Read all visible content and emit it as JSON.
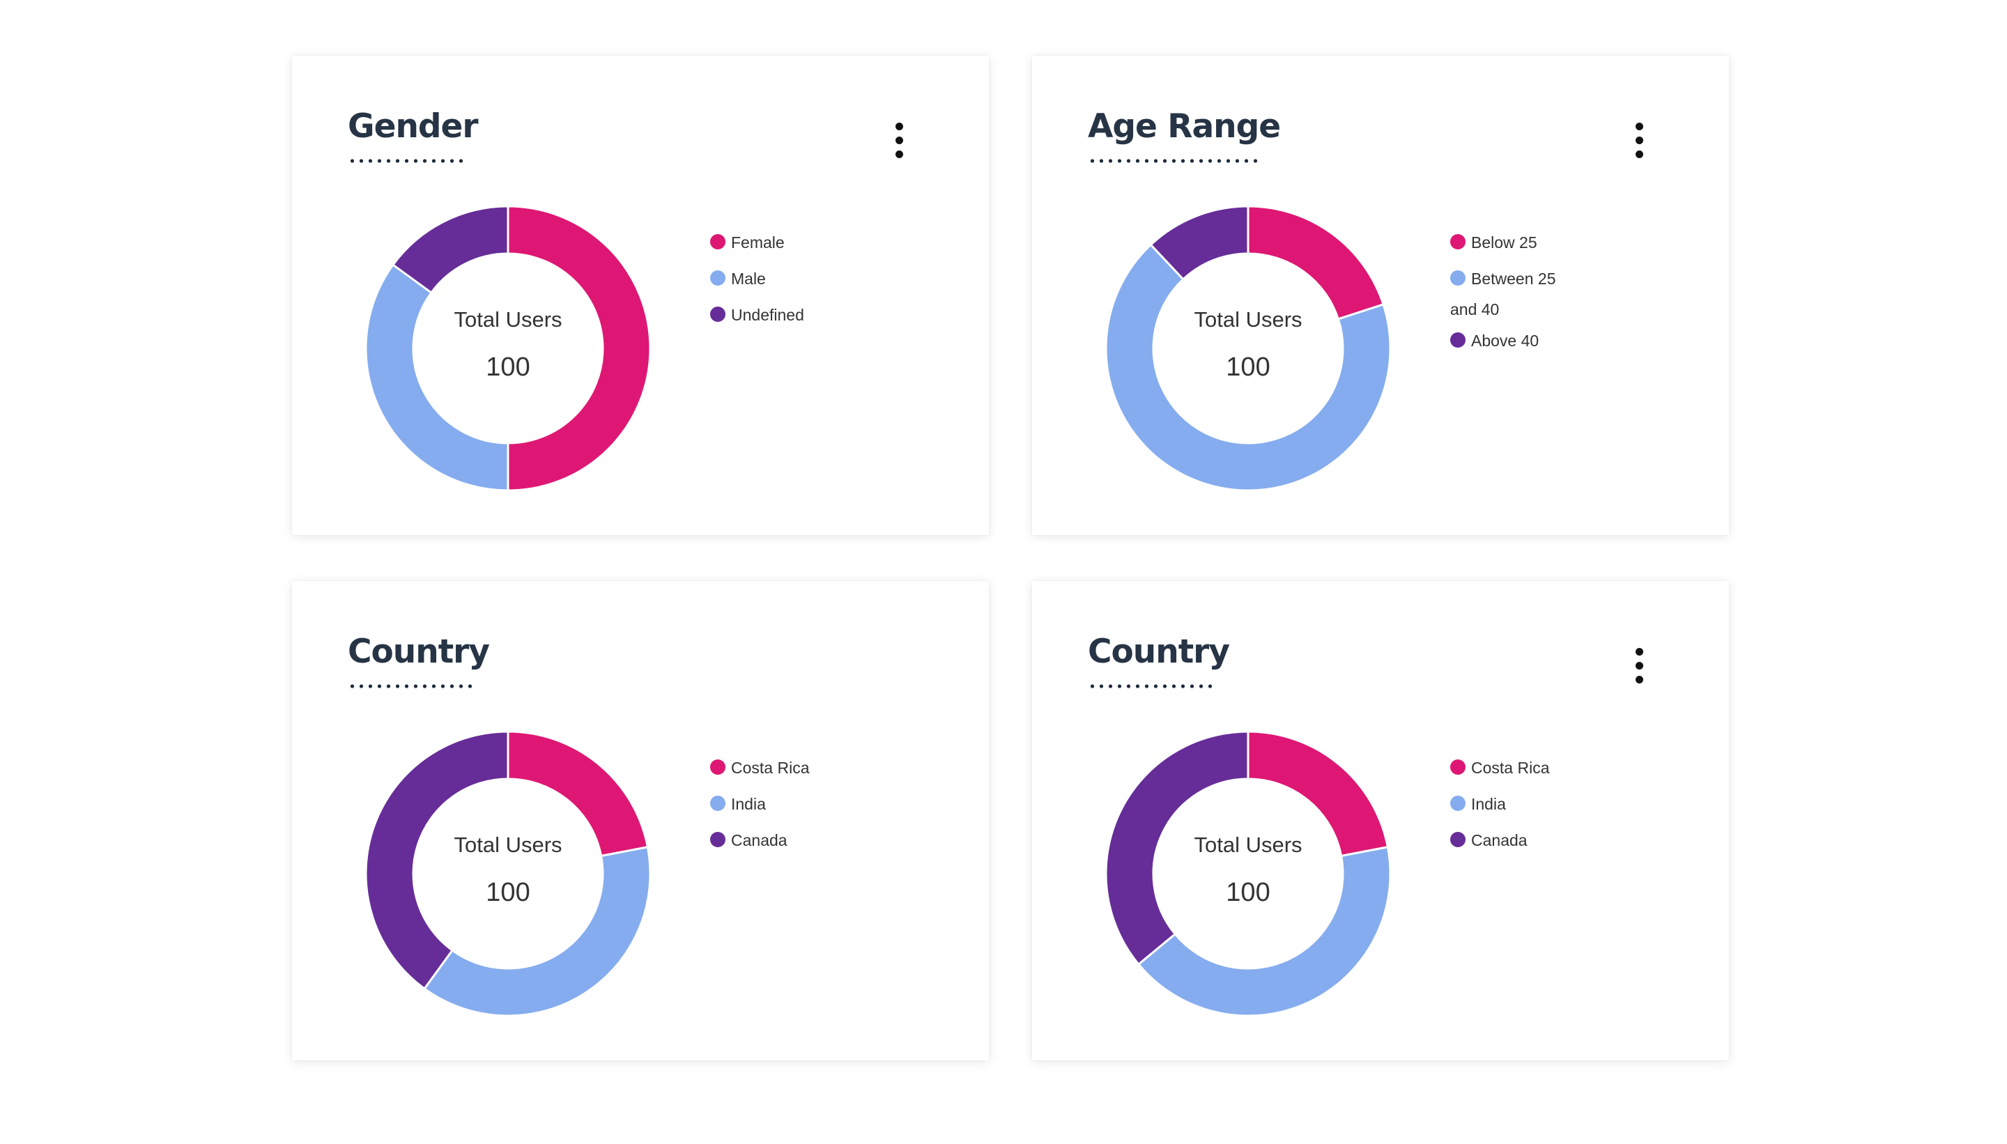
{
  "colors": {
    "pink": "#de1774",
    "blue": "#85acee",
    "purple": "#662d98",
    "title": "#263445"
  },
  "cards": [
    {
      "title": "Gender",
      "has_menu": true,
      "center_label": "Total Users",
      "center_value": "100",
      "legend": [
        {
          "label": "Female",
          "color": "#de1774"
        },
        {
          "label": "Male",
          "color": "#85acee"
        },
        {
          "label": "Undefined",
          "color": "#662d98"
        }
      ]
    },
    {
      "title": "Age Range",
      "has_menu": true,
      "center_label": "Total Users",
      "center_value": "100",
      "legend": [
        {
          "label": "Below 25",
          "color": "#de1774"
        },
        {
          "label": "Between 25 and 40",
          "color": "#85acee"
        },
        {
          "label": "Above 40",
          "color": "#662d98"
        }
      ]
    },
    {
      "title": "Country",
      "has_menu": false,
      "center_label": "Total Users",
      "center_value": "100",
      "legend": [
        {
          "label": "Costa Rica",
          "color": "#de1774"
        },
        {
          "label": "India",
          "color": "#85acee"
        },
        {
          "label": "Canada",
          "color": "#662d98"
        }
      ]
    },
    {
      "title": "Country",
      "has_menu": true,
      "center_label": "Total Users",
      "center_value": "100",
      "legend": [
        {
          "label": "Costa Rica",
          "color": "#de1774"
        },
        {
          "label": "India",
          "color": "#85acee"
        },
        {
          "label": "Canada",
          "color": "#662d98"
        }
      ]
    }
  ],
  "chart_data": [
    {
      "type": "pie",
      "title": "Gender",
      "categories": [
        "Female",
        "Male",
        "Undefined"
      ],
      "values": [
        50,
        35,
        15
      ]
    },
    {
      "type": "pie",
      "title": "Age Range",
      "categories": [
        "Below 25",
        "Between 25 and 40",
        "Above 40"
      ],
      "values": [
        20,
        68,
        12
      ]
    },
    {
      "type": "pie",
      "title": "Country",
      "categories": [
        "Costa Rica",
        "India",
        "Canada"
      ],
      "values": [
        22,
        38,
        40
      ]
    },
    {
      "type": "pie",
      "title": "Country",
      "categories": [
        "Costa Rica",
        "India",
        "Canada"
      ],
      "values": [
        22,
        42,
        36
      ]
    }
  ]
}
